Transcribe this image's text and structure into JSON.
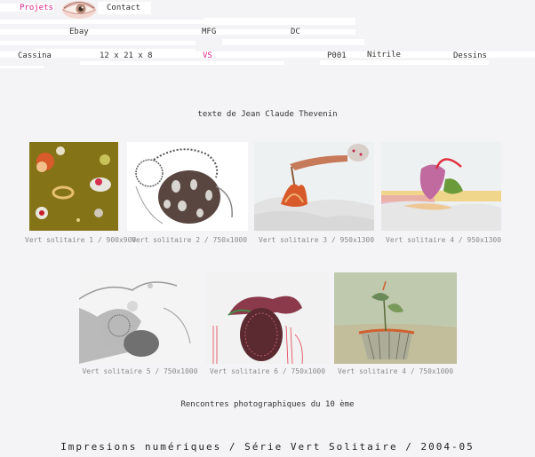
{
  "nav": {
    "row1": [
      {
        "label": "Projets",
        "active": true
      },
      {
        "label": "Contact",
        "active": false
      }
    ],
    "row2": [
      {
        "label": "Ebay"
      },
      {
        "label": "MFG"
      },
      {
        "label": "DC"
      }
    ],
    "row3": [
      {
        "label": "Cassina",
        "active": false
      },
      {
        "label": "12 x 21 x 8",
        "active": false
      },
      {
        "label": "VS",
        "active": true
      },
      {
        "label": "P001",
        "active": false
      },
      {
        "label": "Nitrile",
        "active": false
      },
      {
        "label": "Dessins",
        "active": false
      }
    ]
  },
  "intro": "texte de Jean Claude Thevenin",
  "gallery": {
    "row1": [
      {
        "caption": "Vert solitaire 1 / 900x900"
      },
      {
        "caption": "Vert solitaire 2 / 750x1000"
      },
      {
        "caption": "Vert solitaire 3 / 950x1300"
      },
      {
        "caption": "Vert solitaire 4 / 950x1300"
      }
    ],
    "row2": [
      {
        "caption": "Vert solitaire 5 / 750x1000"
      },
      {
        "caption": "Vert solitaire 6 / 750x1000"
      },
      {
        "caption": "Vert solitaire 4 / 750x1000"
      }
    ]
  },
  "event": "Rencontres photographiques du 10 ème",
  "footer": "Impresions numériques / Série Vert Solitaire / 2004-05",
  "colors": {
    "accent": "#e0248a",
    "background": "#f4f4f6",
    "caption": "#8a8a8a"
  }
}
